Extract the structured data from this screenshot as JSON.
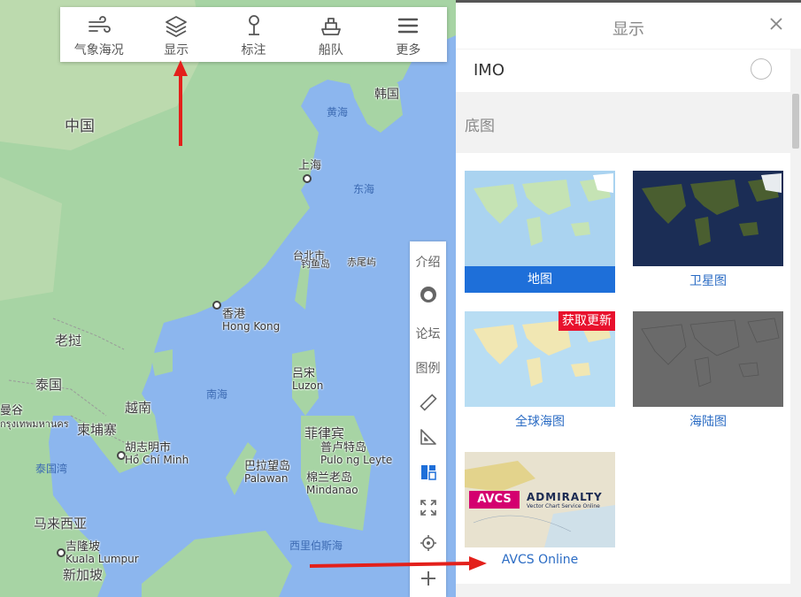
{
  "toolbar": {
    "items": [
      {
        "label": "气象海况",
        "icon": "wind-icon"
      },
      {
        "label": "显示",
        "icon": "layers-icon"
      },
      {
        "label": "标注",
        "icon": "pin-icon"
      },
      {
        "label": "船队",
        "icon": "ship-icon"
      },
      {
        "label": "更多",
        "icon": "menu-icon"
      }
    ]
  },
  "map": {
    "labels": {
      "china": "中国",
      "korea": "韩国",
      "yellow_sea": "黄海",
      "east_sea": "东海",
      "shanghai": "上海",
      "taipei": "台北市",
      "diaoyu": "钓鱼岛",
      "chiwei": "赤尾屿",
      "hongkong": "香港",
      "hongkong_en": "Hong Kong",
      "south_sea": "南海",
      "laos": "老挝",
      "thailand": "泰国",
      "vietnam": "越南",
      "cambodia": "柬埔寨",
      "hcm": "胡志明市",
      "hcm_en": "Hồ Chí Minh",
      "bangkok": "曼谷",
      "gulf_thailand": "泰国湾",
      "luzon": "吕宋",
      "luzon_en": "Luzon",
      "philippines": "菲律宾",
      "palawan": "巴拉望岛",
      "palawan_en": "Palawan",
      "pulong": "普卢特岛",
      "pulong_en": "Pulo ng Leyte",
      "mindanao": "棉兰老岛",
      "mindanao_en": "Mindanao",
      "malaysia": "马来西亚",
      "kl": "吉隆坡",
      "kl_en": "Kuala Lumpur",
      "singapore": "新加坡",
      "celebes": "西里伯斯海",
      "thai_script": "กรุงเทพมหานคร"
    }
  },
  "sidetools": {
    "intro": "介绍",
    "forum": "论坛",
    "legend": "图例"
  },
  "panel": {
    "title": "显示",
    "imo_label": "IMO",
    "imo_checked": false,
    "section_title": "底图",
    "cards": [
      {
        "label": "地图",
        "selected": true
      },
      {
        "label": "卫星图",
        "selected": false
      },
      {
        "label": "全球海图",
        "selected": false,
        "badge": "获取更新"
      },
      {
        "label": "海陆图",
        "selected": false
      },
      {
        "label": "AVCS Online",
        "selected": false
      }
    ],
    "avcs": {
      "tag": "AVCS",
      "brand": "ADMIRALTY",
      "tagline": "Vector Chart Service Online"
    }
  },
  "colors": {
    "accent": "#1e6fd9",
    "badge": "#e8112d",
    "arrow": "#e3201b",
    "sea": "#8cb6ee",
    "land": "#9fd3a0"
  }
}
